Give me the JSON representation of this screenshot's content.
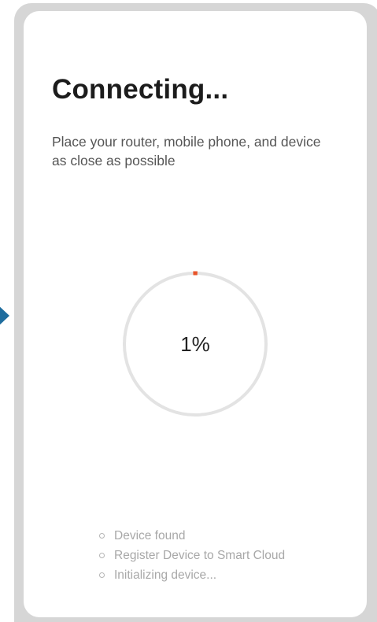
{
  "screen": {
    "title": "Connecting...",
    "subtitle": "Place your router, mobile phone, and device as close as possible"
  },
  "progress": {
    "percent": 1,
    "label": "1%",
    "colors": {
      "track": "#e3e3e3",
      "fill": "#e8542a"
    }
  },
  "steps": [
    {
      "label": "Device found"
    },
    {
      "label": "Register Device to Smart Cloud"
    },
    {
      "label": "Initializing device..."
    }
  ],
  "icons": {
    "side_arrow": "arrow-right-icon",
    "step_bullet": "circle-outline-icon"
  },
  "colors": {
    "accent": "#1f6d9e",
    "frame": "#d6d6d6"
  }
}
